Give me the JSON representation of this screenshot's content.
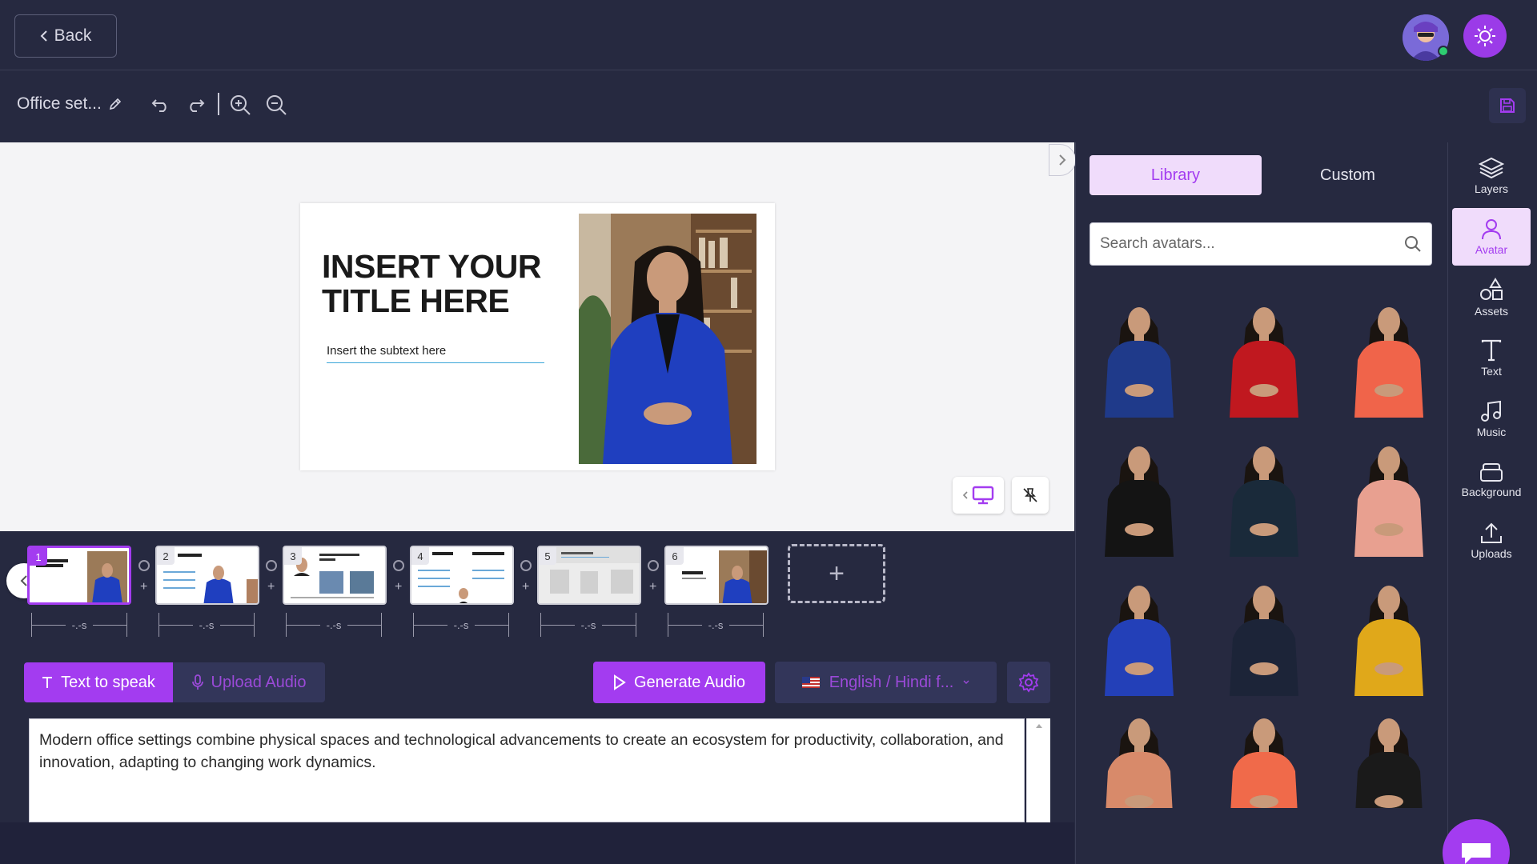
{
  "header": {
    "back_label": "Back"
  },
  "toolbar": {
    "project_name": "Office set..."
  },
  "slide": {
    "title": "INSERT YOUR TITLE HERE",
    "subtext": "Insert the subtext here"
  },
  "timeline": {
    "slides": [
      {
        "num": "1",
        "duration": "-.-s"
      },
      {
        "num": "2",
        "duration": "-.-s"
      },
      {
        "num": "3",
        "duration": "-.-s"
      },
      {
        "num": "4",
        "duration": "-.-s"
      },
      {
        "num": "5",
        "duration": "-.-s"
      },
      {
        "num": "6",
        "duration": "-.-s"
      }
    ],
    "add_symbol": "+"
  },
  "audio": {
    "tts_label": "Text to speak",
    "upload_label": "Upload Audio",
    "generate_label": "Generate Audio",
    "language_label": "English / Hindi f...",
    "script": "Modern office settings combine physical spaces and technological advancements to create an ecosystem for productivity, collaboration, and innovation, adapting to changing work dynamics."
  },
  "panel": {
    "tab_library": "Library",
    "tab_custom": "Custom",
    "search_placeholder": "Search avatars...",
    "avatars": [
      {
        "top": "#1f3a8a",
        "skin": "#c99a7a"
      },
      {
        "top": "#c0181f",
        "skin": "#c99a7a"
      },
      {
        "top": "#f0644a",
        "skin": "#c99a7a"
      },
      {
        "top": "#141414",
        "skin": "#c99a7a"
      },
      {
        "top": "#1a2a3a",
        "skin": "#c99a7a"
      },
      {
        "top": "#e8a090",
        "skin": "#c99a7a"
      },
      {
        "top": "#2340b8",
        "skin": "#c99a7a"
      },
      {
        "top": "#1c2438",
        "skin": "#c99a7a"
      },
      {
        "top": "#e0a81a",
        "skin": "#c99a7a"
      },
      {
        "top": "#d88a6a",
        "skin": "#c99a7a"
      },
      {
        "top": "#f06a4a",
        "skin": "#c99a7a"
      },
      {
        "top": "#1a1a1a",
        "skin": "#c99a7a"
      }
    ]
  },
  "sidenav": {
    "layers": "Layers",
    "avatar": "Avatar",
    "assets": "Assets",
    "text": "Text",
    "music": "Music",
    "background": "Background",
    "uploads": "Uploads"
  },
  "colors": {
    "accent": "#a33cf0",
    "bg": "#262940",
    "accent_light": "#f0dcfb"
  }
}
